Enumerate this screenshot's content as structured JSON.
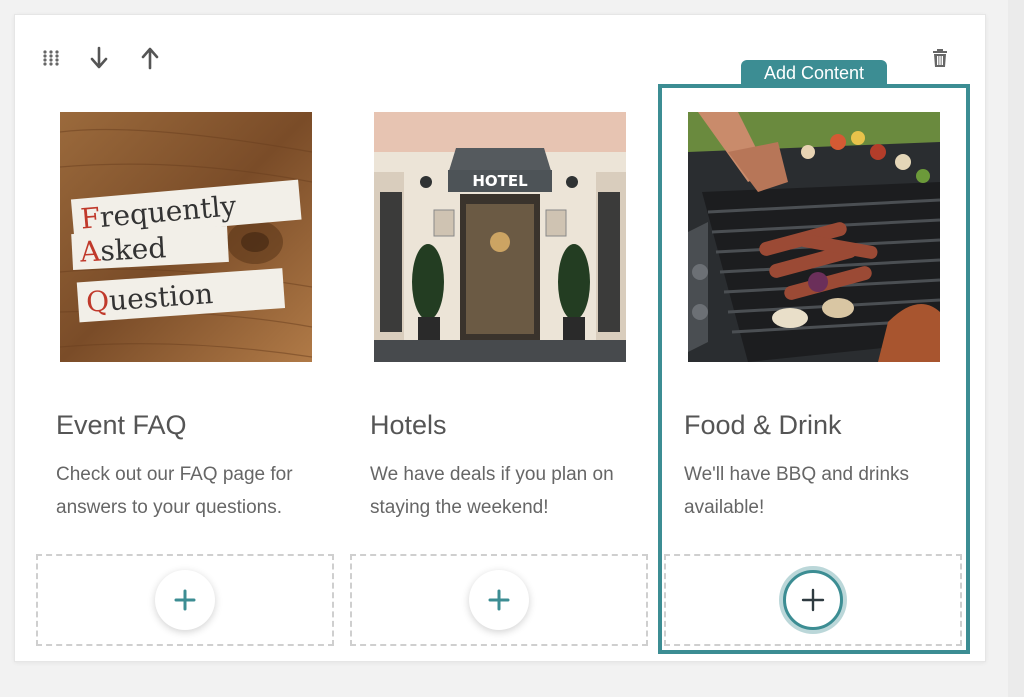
{
  "toolbar": {
    "drag_icon": "drag-grid-icon",
    "move_down_icon": "arrow-down-icon",
    "move_up_icon": "arrow-up-icon",
    "delete_icon": "trash-icon"
  },
  "selected": {
    "tab_label": "Add Content",
    "accent_color": "#3c8d93"
  },
  "cards": [
    {
      "title": "Event FAQ",
      "description": "Check out our FAQ page for answers to your questions.",
      "image": {
        "words": [
          {
            "initial": "F",
            "rest": "requently"
          },
          {
            "initial": "A",
            "rest": "sked"
          },
          {
            "initial": "Q",
            "rest": "uestion"
          }
        ]
      },
      "add_icon": "plus-icon"
    },
    {
      "title": "Hotels",
      "description": "We have deals if you plan on staying the weekend!",
      "image": {
        "sign": "HOTEL"
      },
      "add_icon": "plus-icon"
    },
    {
      "title": "Food & Drink",
      "description": "We'll have BBQ and drinks available!",
      "image": {},
      "add_icon": "plus-icon"
    }
  ]
}
